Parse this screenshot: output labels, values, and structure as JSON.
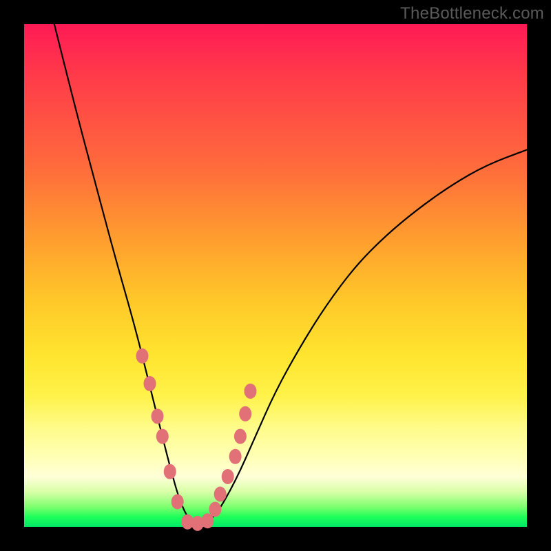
{
  "watermark": "TheBottleneck.com",
  "chart_data": {
    "type": "line",
    "title": "",
    "xlabel": "",
    "ylabel": "",
    "xlim": [
      0,
      100
    ],
    "ylim": [
      0,
      100
    ],
    "grid": false,
    "background_gradient": [
      "#ff1a55",
      "#ff6a3c",
      "#ffc829",
      "#fff24a",
      "#ffffd8",
      "#1fff5a"
    ],
    "series": [
      {
        "name": "curve",
        "color": "#000000",
        "x": [
          6,
          10,
          14,
          18,
          22,
          25,
          27,
          29,
          31,
          33,
          35,
          38,
          42,
          46,
          50,
          55,
          60,
          66,
          72,
          78,
          85,
          92,
          100
        ],
        "values": [
          100,
          84,
          69,
          54,
          40,
          28,
          20,
          12,
          5,
          1,
          0,
          2,
          9,
          18,
          27,
          36,
          44,
          52,
          58,
          63,
          68,
          72,
          75
        ]
      },
      {
        "name": "highlight-dots",
        "color": "#e17077",
        "type": "scatter",
        "x": [
          23.5,
          25.0,
          26.5,
          27.5,
          29.0,
          30.5,
          32.5,
          34.5,
          36.5,
          38.0,
          39.0,
          40.5,
          42.0,
          43.0,
          44.0,
          45.0
        ],
        "values": [
          34.0,
          28.5,
          22.0,
          18.0,
          11.0,
          5.0,
          1.0,
          0.7,
          1.2,
          3.5,
          6.5,
          10.0,
          14.0,
          18.0,
          22.5,
          27.0
        ]
      }
    ]
  }
}
